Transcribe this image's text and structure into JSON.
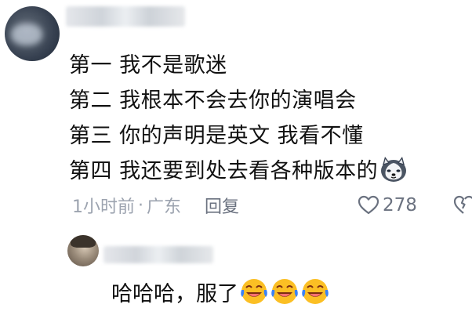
{
  "comment": {
    "lines": [
      "第一 我不是歌迷",
      "第二 我根本不会去你的演唱会",
      "第三 你的声明是英文 我看不懂",
      "第四 我还要到处去看各种版本的"
    ],
    "trailing_emoji": "husky-dog-icon",
    "time": "1小时前",
    "separator": "·",
    "location": "广东",
    "reply_label": "回复",
    "like_count": "278"
  },
  "reply": {
    "text": "哈哈哈，服了",
    "emojis": [
      "laughing-tears-icon",
      "laughing-tears-icon",
      "laughing-tears-icon"
    ]
  },
  "colors": {
    "text": "#111111",
    "meta": "#9ca3af",
    "icon": "#6b7280",
    "emoji_yellow": "#fbbf24"
  }
}
